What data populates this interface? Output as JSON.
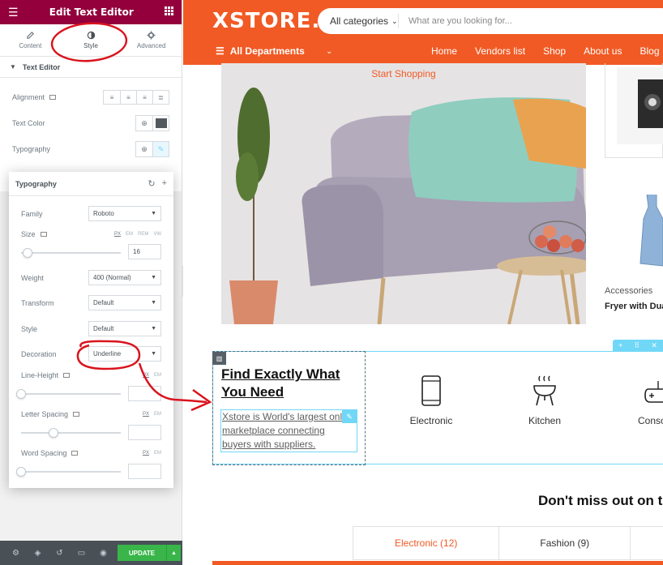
{
  "editor": {
    "title": "Edit Text Editor",
    "tabs": [
      {
        "label": "Content",
        "icon": "pencil-icon"
      },
      {
        "label": "Style",
        "icon": "half-circle-icon"
      },
      {
        "label": "Advanced",
        "icon": "gear-icon"
      }
    ],
    "section_title": "Text Editor",
    "controls": {
      "alignment_label": "Alignment",
      "text_color_label": "Text Color",
      "text_color_value": "#54595f",
      "typography_label": "Typography"
    },
    "typography": {
      "title": "Typography",
      "family_label": "Family",
      "family_value": "Roboto",
      "size_label": "Size",
      "size_units": [
        "PX",
        "EM",
        "REM",
        "VW"
      ],
      "size_value": "16",
      "weight_label": "Weight",
      "weight_value": "400 (Normal)",
      "transform_label": "Transform",
      "transform_value": "Default",
      "style_label": "Style",
      "style_value": "Default",
      "decoration_label": "Decoration",
      "decoration_value": "Underline",
      "line_height_label": "Line-Height",
      "line_height_units": [
        "PX",
        "EM"
      ],
      "letter_spacing_label": "Letter Spacing",
      "letter_spacing_units": [
        "PX",
        "EM"
      ],
      "word_spacing_label": "Word Spacing",
      "word_spacing_units": [
        "PX",
        "EM"
      ]
    },
    "footer": {
      "update_label": "UPDATE"
    },
    "colors": {
      "header": "#93003c",
      "update": "#39b54a",
      "footer": "#495157"
    }
  },
  "site": {
    "logo": "XSTORE.",
    "search": {
      "category": "All categories",
      "placeholder": "What are you looking for..."
    },
    "departments_label": "All Departments",
    "nav_links": [
      "Home",
      "Vendors list",
      "Shop",
      "About us",
      "Blog"
    ],
    "hero_link": "Start Shopping",
    "side_category": "Accessories",
    "side_product": "Fryer with Dual",
    "section": {
      "heading": "Find Exactly What You Need",
      "text": "Xstore is World's largest online marketplace connecting buyers with suppliers.",
      "categories": [
        "Electronic",
        "Kitchen",
        "Consoles"
      ]
    },
    "dont_miss": "Don't miss out on the",
    "product_tabs": [
      "Electronic (12)",
      "Fashion (9)",
      ""
    ],
    "colors": {
      "brand": "#f15a24",
      "editor_outline": "#71d7f7"
    }
  }
}
